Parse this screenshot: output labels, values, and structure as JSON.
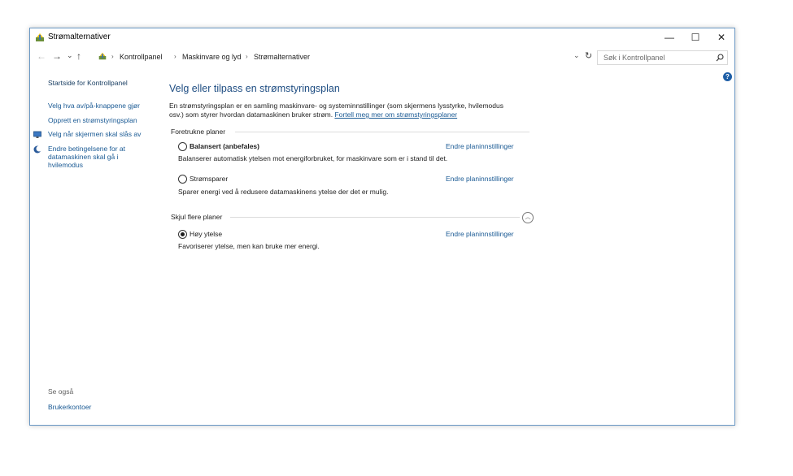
{
  "window": {
    "title": "Strømalternativer",
    "minimize_glyph": "—",
    "maximize_glyph": "☐",
    "close_glyph": "✕"
  },
  "nav": {
    "back_glyph": "←",
    "forward_glyph": "→",
    "recent_glyph": "⌄",
    "up_glyph": "↑",
    "breadcrumbs": [
      "Kontrollpanel",
      "Maskinvare og lyd",
      "Strømalternativer"
    ],
    "refresh_glyph": "↻",
    "dropdown_glyph": "⌄",
    "search_placeholder": "Søk i Kontrollpanel"
  },
  "sidebar": {
    "home": "Startside for Kontrollpanel",
    "links": [
      {
        "label": "Velg hva av/på-knappene gjør",
        "icon": ""
      },
      {
        "label": "Opprett en strømstyringsplan",
        "icon": ""
      },
      {
        "label": "Velg når skjermen skal slås av",
        "icon": "monitor-icon"
      },
      {
        "label": "Endre betingelsene for at",
        "icon": "moon-icon"
      }
    ],
    "sleep_lines": [
      "datamaskinen skal gå i",
      "hvilemodus"
    ],
    "see_also": {
      "heading": "Se også",
      "links": [
        "Brukerkontoer"
      ]
    }
  },
  "main": {
    "title": "Velg eller tilpass en strømstyringsplan",
    "description_1": "En strømstyringsplan er en samling maskinvare- og systeminnstillinger (som skjermens lysstyrke, hvilemodus",
    "description_2": "osv.) som styrer hvordan datamaskinen bruker strøm.",
    "learn_more": "Fortell meg mer om strømstyringsplaner",
    "preferred_heading": "Foretrukne planer",
    "hidden_heading": "Skjul flere planer",
    "plans": [
      {
        "name": "Balansert (anbefales)",
        "description": "Balanserer automatisk ytelsen mot energiforbruket, for maskinvare som er i stand til det.",
        "link": "Endre planinnstillinger",
        "selected": false
      },
      {
        "name": "Strømsparer",
        "description": "Sparer energi ved å redusere datamaskinens ytelse der det er mulig.",
        "link": "Endre planinnstillinger",
        "selected": false
      },
      {
        "name": "Høy ytelse",
        "description": "Favoriserer ytelse, men kan bruke mer energi.",
        "link": "Endre planinnstillinger",
        "selected": true
      }
    ]
  },
  "colors": {
    "link": "#1a5a94",
    "title": "#1e4d82",
    "window_border": "#6a98c4",
    "help": "#1e5ea6"
  }
}
